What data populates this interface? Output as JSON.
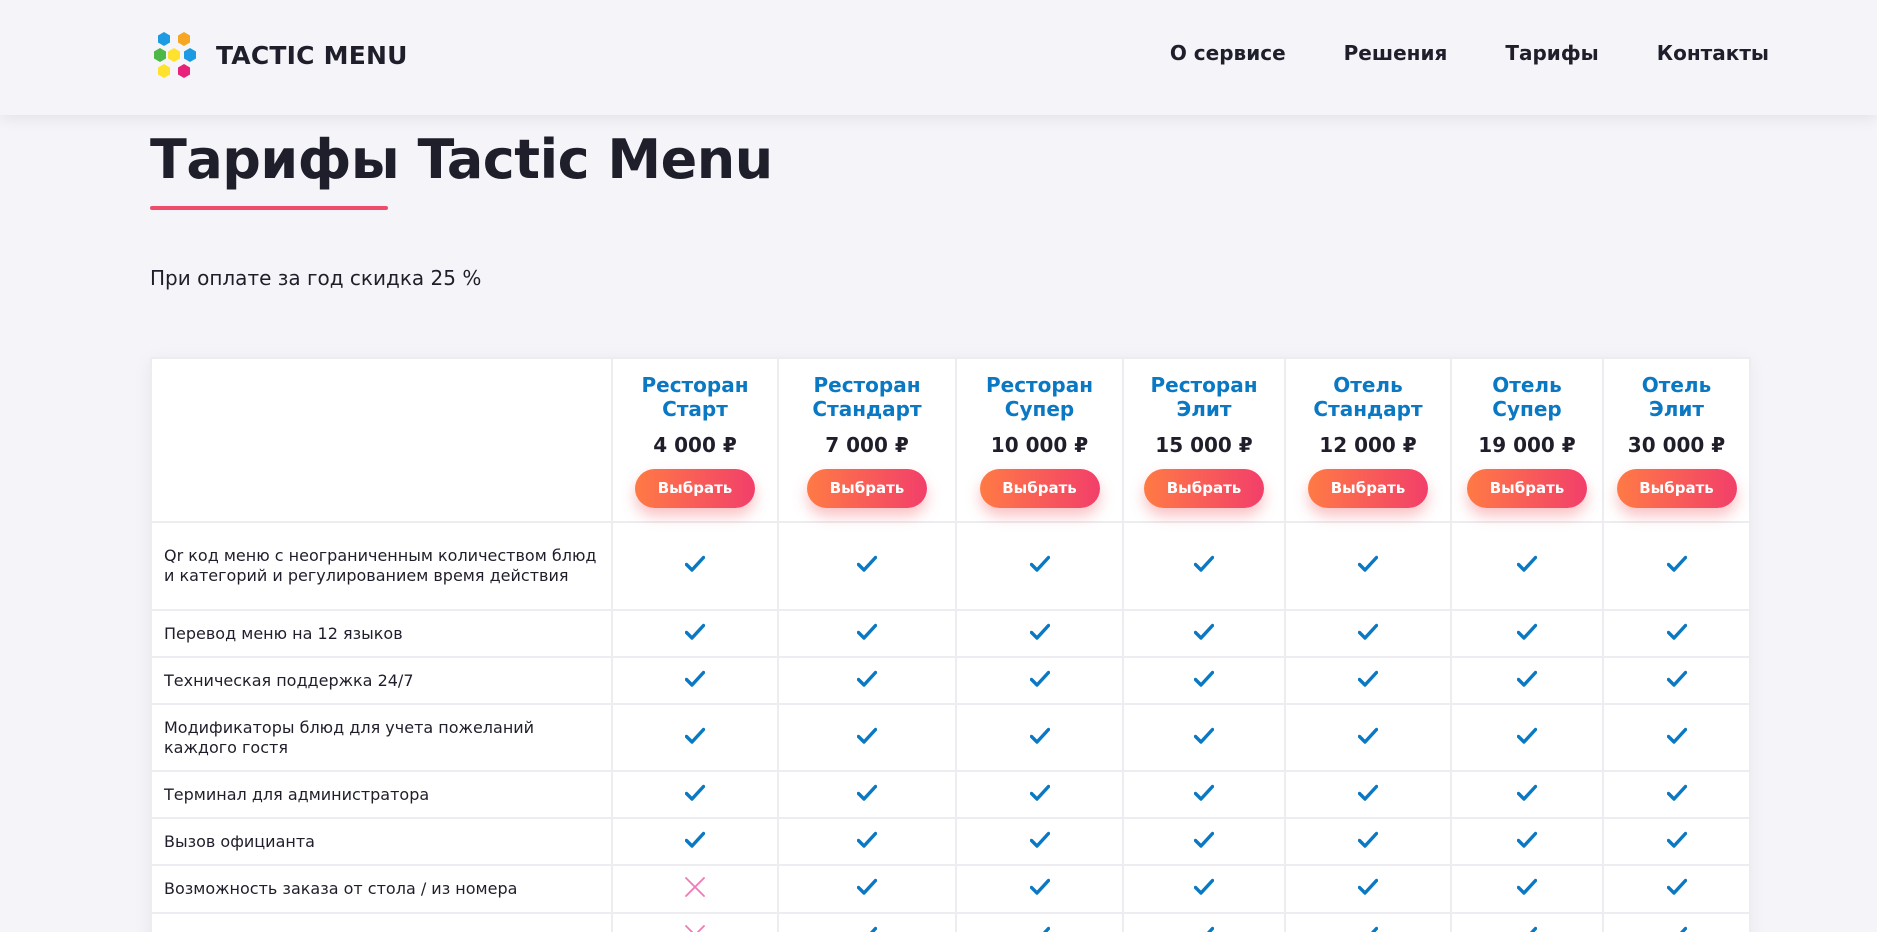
{
  "header": {
    "logo_text": "TACTIC MENU",
    "nav": [
      "О сервисе",
      "Решения",
      "Тарифы",
      "Контакты"
    ]
  },
  "page": {
    "title": "Тарифы Tactic Menu",
    "discount_note": "При оплате за год скидка 25 %"
  },
  "colors": {
    "accent_blue": "#0a78c2",
    "accent_red": "#ef4b6b",
    "button_gradient": [
      "#ff7a45",
      "#f23f6a"
    ],
    "cross_pink": "#f07ab6"
  },
  "plans": [
    {
      "name": "Ресторан\nСтарт",
      "price": "4 000 ₽",
      "button": "Выбрать"
    },
    {
      "name": "Ресторан\nСтандарт",
      "price": "7 000 ₽",
      "button": "Выбрать"
    },
    {
      "name": "Ресторан\nСупер",
      "price": "10 000 ₽",
      "button": "Выбрать"
    },
    {
      "name": "Ресторан\nЭлит",
      "price": "15 000 ₽",
      "button": "Выбрать"
    },
    {
      "name": "Отель\nСтандарт",
      "price": "12 000 ₽",
      "button": "Выбрать"
    },
    {
      "name": "Отель\nСупер",
      "price": "19 000 ₽",
      "button": "Выбрать"
    },
    {
      "name": "Отель\nЭлит",
      "price": "30 000 ₽",
      "button": "Выбрать"
    }
  ],
  "features": [
    {
      "label": "Qr код меню с неограниченным количеством блюд и категорий и регулированием время действия",
      "marks": [
        "check",
        "check",
        "check",
        "check",
        "check",
        "check",
        "check"
      ]
    },
    {
      "label": "Перевод меню на 12 языков",
      "marks": [
        "check",
        "check",
        "check",
        "check",
        "check",
        "check",
        "check"
      ]
    },
    {
      "label": "Техническая поддержка 24/7",
      "marks": [
        "check",
        "check",
        "check",
        "check",
        "check",
        "check",
        "check"
      ]
    },
    {
      "label": "Модификаторы блюд для учета пожеланий каждого гостя",
      "marks": [
        "check",
        "check",
        "check",
        "check",
        "check",
        "check",
        "check"
      ]
    },
    {
      "label": "Терминал для администратора",
      "marks": [
        "check",
        "check",
        "check",
        "check",
        "check",
        "check",
        "check"
      ]
    },
    {
      "label": "Вызов официанта",
      "marks": [
        "check",
        "check",
        "check",
        "check",
        "check",
        "check",
        "check"
      ]
    },
    {
      "label": "Возможность заказа от стола / из номера",
      "marks": [
        "cross",
        "check",
        "check",
        "check",
        "check",
        "check",
        "check"
      ]
    },
    {
      "label": "",
      "marks": [
        "cross",
        "check",
        "check",
        "check",
        "check",
        "check",
        "check"
      ]
    }
  ]
}
